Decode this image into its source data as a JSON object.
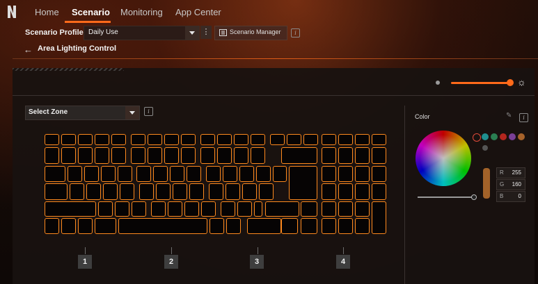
{
  "nav": {
    "tabs": [
      {
        "label": "Home"
      },
      {
        "label": "Scenario"
      },
      {
        "label": "Monitoring"
      },
      {
        "label": "App Center"
      }
    ],
    "active_tab": "Scenario"
  },
  "profile": {
    "label": "Scenario Profile",
    "selected": "Daily Use",
    "manager_label": "Scenario Manager"
  },
  "page": {
    "title": "Area Lighting Control"
  },
  "zone": {
    "select_label": "Select Zone",
    "markers": [
      "1",
      "2",
      "3",
      "4"
    ]
  },
  "color": {
    "title": "Color",
    "swatches": [
      "#1f8f8f",
      "#2a7f52",
      "#b3261e",
      "#7a3f96",
      "#a7622a"
    ],
    "rgb": [
      {
        "k": "R",
        "v": "255"
      },
      {
        "k": "G",
        "v": "160"
      },
      {
        "k": "B",
        "v": "0"
      }
    ]
  },
  "brightness": {
    "level_percent": 90
  },
  "colors": {
    "accent": "#ff6a1a",
    "key_outline": "#ff8a1e"
  },
  "icons": [
    "predator-logo",
    "chevron-down-icon",
    "kebab-icon",
    "scenario-manager-icon",
    "info-icon",
    "back-arrow-icon",
    "brightness-low-icon",
    "brightness-high-icon",
    "eyedropper-icon",
    "no-color-icon"
  ]
}
